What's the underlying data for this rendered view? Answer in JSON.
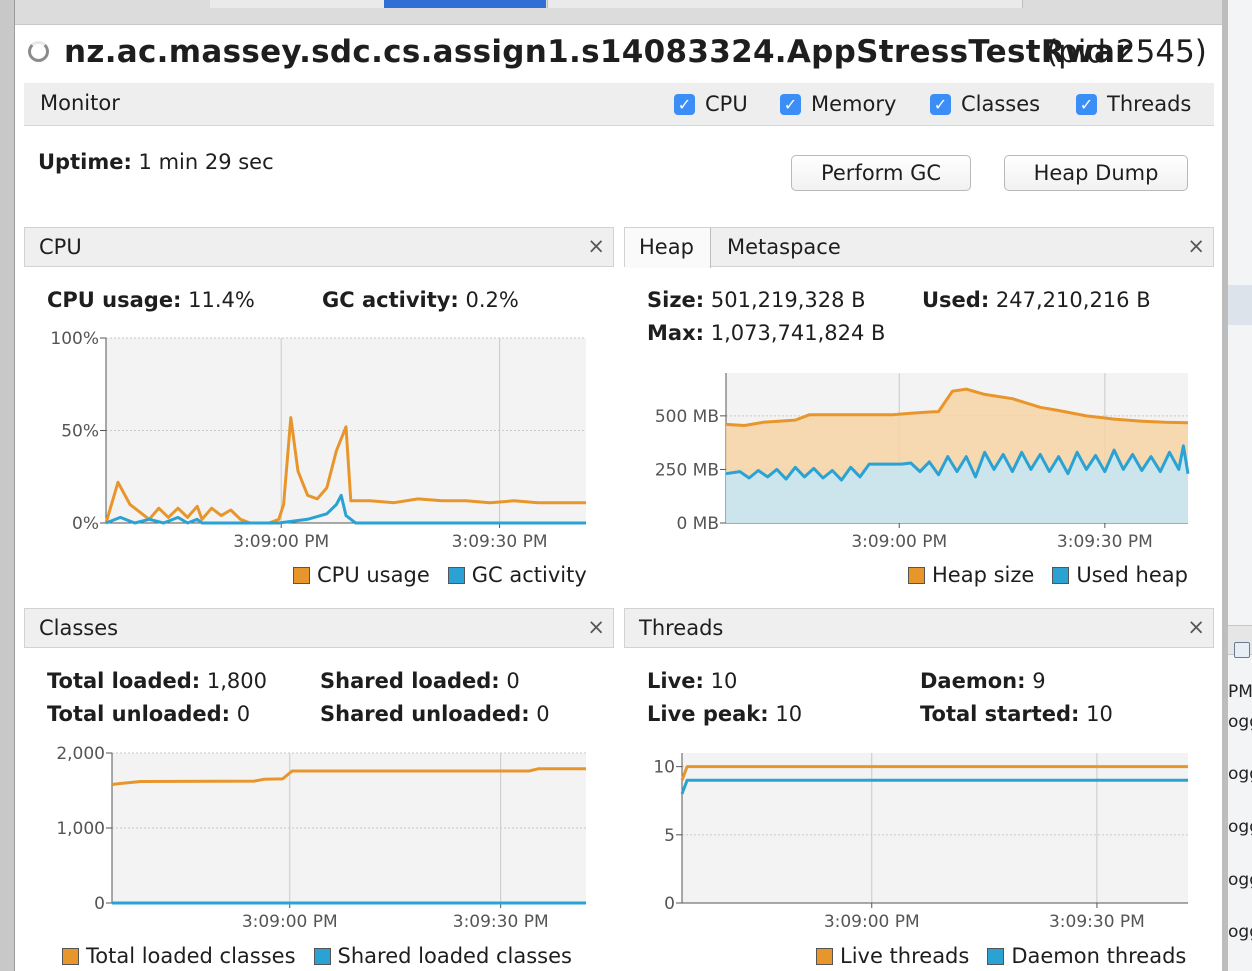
{
  "app": {
    "title": "nz.ac.massey.sdc.cs.assign1.s14083324.AppStressTestRwar",
    "pid": "(pid 2545)"
  },
  "monitor": {
    "label": "Monitor",
    "checkboxes": [
      {
        "label": "CPU",
        "checked": true
      },
      {
        "label": "Memory",
        "checked": true
      },
      {
        "label": "Classes",
        "checked": true
      },
      {
        "label": "Threads",
        "checked": true
      }
    ],
    "uptime_label": "Uptime:",
    "uptime_value": "1 min 29 sec",
    "buttons": {
      "perform_gc": "Perform GC",
      "heap_dump": "Heap Dump"
    }
  },
  "colors": {
    "orange": "#e8962b",
    "blue": "#2aa3d4",
    "accent": "#3a8ef5"
  },
  "cpu_panel": {
    "title": "CPU",
    "close": "×",
    "stats": [
      {
        "label": "CPU usage:",
        "value": "11.4%"
      },
      {
        "label": "GC activity:",
        "value": "0.2%"
      }
    ],
    "legend": [
      "CPU usage",
      "GC activity"
    ]
  },
  "memory_panel": {
    "tabs": [
      "Heap",
      "Metaspace"
    ],
    "active_tab": "Heap",
    "close": "×",
    "stats": [
      {
        "label": "Size:",
        "value": "501,219,328 B"
      },
      {
        "label": "Used:",
        "value": "247,210,216 B"
      },
      {
        "label": "Max:",
        "value": "1,073,741,824 B"
      }
    ],
    "legend": [
      "Heap size",
      "Used heap"
    ]
  },
  "classes_panel": {
    "title": "Classes",
    "close": "×",
    "stats": [
      {
        "label": "Total loaded:",
        "value": "1,800"
      },
      {
        "label": "Shared loaded:",
        "value": "0"
      },
      {
        "label": "Total unloaded:",
        "value": "0"
      },
      {
        "label": "Shared unloaded:",
        "value": "0"
      }
    ],
    "legend": [
      "Total loaded classes",
      "Shared loaded classes"
    ]
  },
  "threads_panel": {
    "title": "Threads",
    "close": "×",
    "stats": [
      {
        "label": "Live:",
        "value": "10"
      },
      {
        "label": "Daemon:",
        "value": "9"
      },
      {
        "label": "Live peak:",
        "value": "10"
      },
      {
        "label": "Total started:",
        "value": "10"
      }
    ],
    "legend": [
      "Live threads",
      "Daemon threads"
    ]
  },
  "right_panel": {
    "labels": [
      "PM",
      "ogg",
      "ogg",
      "ogg",
      "ogg",
      "ogg"
    ]
  },
  "chart_data": [
    {
      "id": "cpu",
      "type": "line",
      "xticks": [
        "3:09:00 PM",
        "3:09:30 PM"
      ],
      "xtick_positions": [
        0.365,
        0.82
      ],
      "yticks": [
        "0%",
        "50%",
        "100%"
      ],
      "ytick_values": [
        0,
        50,
        100
      ],
      "ylim": [
        0,
        100
      ],
      "series": [
        {
          "name": "CPU usage",
          "color": "#e8962b",
          "fill": false,
          "points": [
            [
              0,
              0
            ],
            [
              0.025,
              22
            ],
            [
              0.05,
              10
            ],
            [
              0.07,
              6
            ],
            [
              0.09,
              2
            ],
            [
              0.11,
              8
            ],
            [
              0.13,
              3
            ],
            [
              0.15,
              8
            ],
            [
              0.17,
              3
            ],
            [
              0.19,
              9
            ],
            [
              0.2,
              2
            ],
            [
              0.22,
              8
            ],
            [
              0.24,
              4
            ],
            [
              0.26,
              7
            ],
            [
              0.28,
              2
            ],
            [
              0.3,
              0
            ],
            [
              0.34,
              0
            ],
            [
              0.36,
              2
            ],
            [
              0.37,
              10
            ],
            [
              0.385,
              57
            ],
            [
              0.4,
              28
            ],
            [
              0.42,
              15
            ],
            [
              0.44,
              13
            ],
            [
              0.46,
              19
            ],
            [
              0.48,
              39
            ],
            [
              0.5,
              52
            ],
            [
              0.51,
              12
            ],
            [
              0.55,
              12
            ],
            [
              0.6,
              11
            ],
            [
              0.65,
              13
            ],
            [
              0.7,
              12
            ],
            [
              0.75,
              12
            ],
            [
              0.8,
              11
            ],
            [
              0.85,
              12
            ],
            [
              0.9,
              11
            ],
            [
              1,
              11
            ]
          ]
        },
        {
          "name": "GC activity",
          "color": "#2aa3d4",
          "fill": false,
          "points": [
            [
              0,
              0
            ],
            [
              0.03,
              3
            ],
            [
              0.06,
              0
            ],
            [
              0.09,
              2
            ],
            [
              0.12,
              0
            ],
            [
              0.15,
              3
            ],
            [
              0.17,
              0
            ],
            [
              0.19,
              2
            ],
            [
              0.2,
              0
            ],
            [
              0.36,
              0
            ],
            [
              0.42,
              2
            ],
            [
              0.46,
              5
            ],
            [
              0.48,
              10
            ],
            [
              0.49,
              15
            ],
            [
              0.5,
              4
            ],
            [
              0.52,
              0
            ],
            [
              1,
              0
            ]
          ]
        }
      ]
    },
    {
      "id": "heap",
      "type": "area",
      "xticks": [
        "3:09:00 PM",
        "3:09:30 PM"
      ],
      "xtick_positions": [
        0.375,
        0.82
      ],
      "yticks": [
        "0 MB",
        "250 MB",
        "500 MB"
      ],
      "ytick_values": [
        0,
        250,
        500
      ],
      "ylim": [
        0,
        700
      ],
      "series": [
        {
          "name": "Heap size",
          "color": "#e8962b",
          "fill": true,
          "points": [
            [
              0,
              460
            ],
            [
              0.04,
              455
            ],
            [
              0.08,
              470
            ],
            [
              0.15,
              480
            ],
            [
              0.18,
              505
            ],
            [
              0.3,
              505
            ],
            [
              0.36,
              505
            ],
            [
              0.4,
              512
            ],
            [
              0.44,
              518
            ],
            [
              0.46,
              520
            ],
            [
              0.49,
              615
            ],
            [
              0.52,
              625
            ],
            [
              0.56,
              600
            ],
            [
              0.62,
              580
            ],
            [
              0.68,
              540
            ],
            [
              0.72,
              525
            ],
            [
              0.78,
              500
            ],
            [
              0.84,
              485
            ],
            [
              0.9,
              475
            ],
            [
              0.95,
              470
            ],
            [
              1,
              468
            ]
          ]
        },
        {
          "name": "Used heap",
          "color": "#2aa3d4",
          "fill": true,
          "points": [
            [
              0,
              230
            ],
            [
              0.03,
              240
            ],
            [
              0.05,
              210
            ],
            [
              0.07,
              245
            ],
            [
              0.09,
              215
            ],
            [
              0.11,
              250
            ],
            [
              0.13,
              205
            ],
            [
              0.15,
              260
            ],
            [
              0.17,
              215
            ],
            [
              0.19,
              255
            ],
            [
              0.21,
              210
            ],
            [
              0.23,
              245
            ],
            [
              0.25,
              200
            ],
            [
              0.27,
              260
            ],
            [
              0.29,
              215
            ],
            [
              0.31,
              275
            ],
            [
              0.38,
              275
            ],
            [
              0.4,
              280
            ],
            [
              0.42,
              240
            ],
            [
              0.44,
              285
            ],
            [
              0.46,
              225
            ],
            [
              0.48,
              310
            ],
            [
              0.5,
              240
            ],
            [
              0.52,
              310
            ],
            [
              0.54,
              215
            ],
            [
              0.56,
              330
            ],
            [
              0.58,
              250
            ],
            [
              0.6,
              320
            ],
            [
              0.62,
              240
            ],
            [
              0.64,
              330
            ],
            [
              0.66,
              250
            ],
            [
              0.68,
              320
            ],
            [
              0.7,
              240
            ],
            [
              0.72,
              310
            ],
            [
              0.74,
              230
            ],
            [
              0.76,
              330
            ],
            [
              0.78,
              250
            ],
            [
              0.8,
              315
            ],
            [
              0.82,
              240
            ],
            [
              0.84,
              340
            ],
            [
              0.86,
              250
            ],
            [
              0.88,
              320
            ],
            [
              0.9,
              245
            ],
            [
              0.92,
              310
            ],
            [
              0.94,
              240
            ],
            [
              0.96,
              330
            ],
            [
              0.98,
              250
            ],
            [
              0.99,
              360
            ],
            [
              1,
              230
            ]
          ]
        }
      ]
    },
    {
      "id": "classes",
      "type": "line",
      "xticks": [
        "3:09:00 PM",
        "3:09:30 PM"
      ],
      "xtick_positions": [
        0.375,
        0.82
      ],
      "yticks": [
        "0",
        "1,000",
        "2,000"
      ],
      "ytick_values": [
        0,
        1000,
        2000
      ],
      "ylim": [
        0,
        2000
      ],
      "series": [
        {
          "name": "Total loaded classes",
          "color": "#e8962b",
          "fill": false,
          "points": [
            [
              0,
              1580
            ],
            [
              0.02,
              1595
            ],
            [
              0.06,
              1620
            ],
            [
              0.3,
              1625
            ],
            [
              0.32,
              1650
            ],
            [
              0.36,
              1655
            ],
            [
              0.38,
              1760
            ],
            [
              0.5,
              1760
            ],
            [
              0.88,
              1760
            ],
            [
              0.9,
              1790
            ],
            [
              1,
              1790
            ]
          ]
        },
        {
          "name": "Shared loaded classes",
          "color": "#2aa3d4",
          "fill": false,
          "points": [
            [
              0,
              0
            ],
            [
              1,
              0
            ]
          ]
        }
      ]
    },
    {
      "id": "threads",
      "type": "line",
      "xticks": [
        "3:09:00 PM",
        "3:09:30 PM"
      ],
      "xtick_positions": [
        0.375,
        0.82
      ],
      "yticks": [
        "0",
        "5",
        "10"
      ],
      "ytick_values": [
        0,
        5,
        10
      ],
      "ylim": [
        0,
        11
      ],
      "series": [
        {
          "name": "Live threads",
          "color": "#e8962b",
          "fill": false,
          "points": [
            [
              0,
              9
            ],
            [
              0.01,
              10
            ],
            [
              1,
              10
            ]
          ]
        },
        {
          "name": "Daemon threads",
          "color": "#2aa3d4",
          "fill": false,
          "points": [
            [
              0,
              8
            ],
            [
              0.01,
              9
            ],
            [
              1,
              9
            ]
          ]
        }
      ]
    }
  ]
}
